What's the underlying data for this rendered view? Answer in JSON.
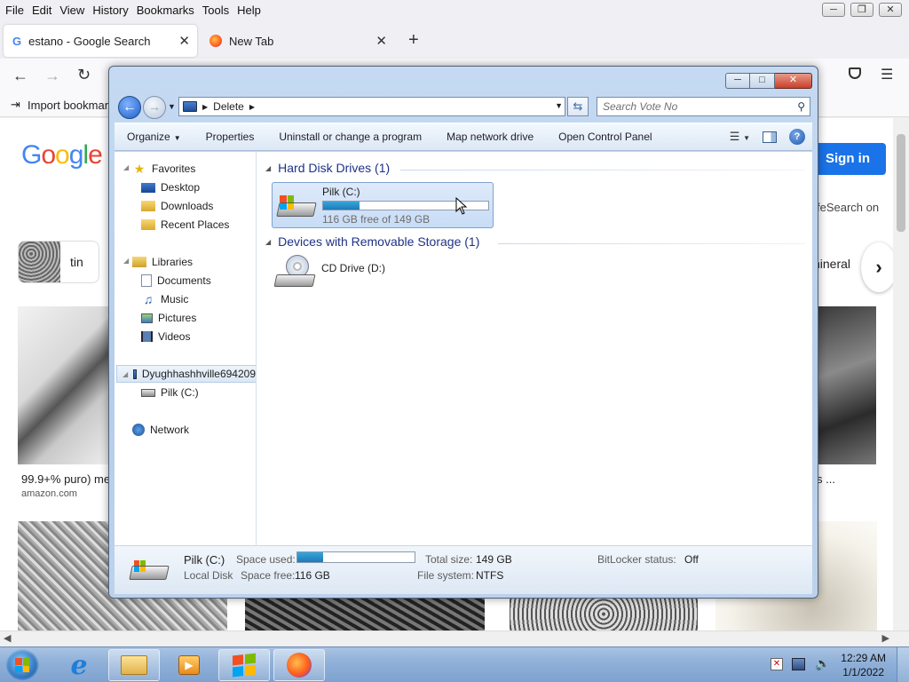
{
  "firefox": {
    "menu": [
      "File",
      "Edit",
      "View",
      "History",
      "Bookmarks",
      "Tools",
      "Help"
    ],
    "tabs": [
      {
        "label": "estano - Google Search",
        "active": true
      },
      {
        "label": "New Tab",
        "active": false
      }
    ],
    "bookmarks_import": "Import bookmark",
    "google": {
      "sign_in": "Sign in",
      "safesearch": "feSearch on",
      "chip_left": "tin",
      "chip_right": "nineral",
      "result1_title": "99.9+% puro) met",
      "result1_source": "amazon.com",
      "result_right_title": "s ..."
    }
  },
  "explorer": {
    "address": {
      "segment": "Delete"
    },
    "search": {
      "placeholder": "Search Vote No"
    },
    "toolbar": {
      "organize": "Organize",
      "properties": "Properties",
      "uninstall": "Uninstall or change a program",
      "map_drive": "Map network drive",
      "control_panel": "Open Control Panel"
    },
    "nav": {
      "favorites": "Favorites",
      "desktop": "Desktop",
      "downloads": "Downloads",
      "recent": "Recent Places",
      "libraries": "Libraries",
      "documents": "Documents",
      "music": "Music",
      "pictures": "Pictures",
      "videos": "Videos",
      "computer": "Dyughhashhville694209",
      "drive_c": "Pilk (C:)",
      "network": "Network"
    },
    "groups": {
      "hdd": "Hard Disk Drives (1)",
      "removable": "Devices with Removable Storage (1)"
    },
    "drives": {
      "c_name": "Pilk (C:)",
      "c_free": "116 GB free of 149 GB",
      "c_used_fraction": 0.22,
      "d_name": "CD Drive (D:)"
    },
    "details": {
      "name": "Pilk (C:)",
      "type": "Local Disk",
      "space_used_label": "Space used:",
      "space_free_label": "Space free:",
      "space_free": "116 GB",
      "total_size_label": "Total size:",
      "total_size": "149 GB",
      "filesystem_label": "File system:",
      "filesystem": "NTFS",
      "bitlocker_label": "BitLocker status:",
      "bitlocker": "Off"
    }
  },
  "taskbar": {
    "time": "12:29 AM",
    "date": "1/1/2022"
  },
  "colors": {
    "accent_blue": "#1a73e8",
    "drive_bar": "#1f79b8"
  }
}
